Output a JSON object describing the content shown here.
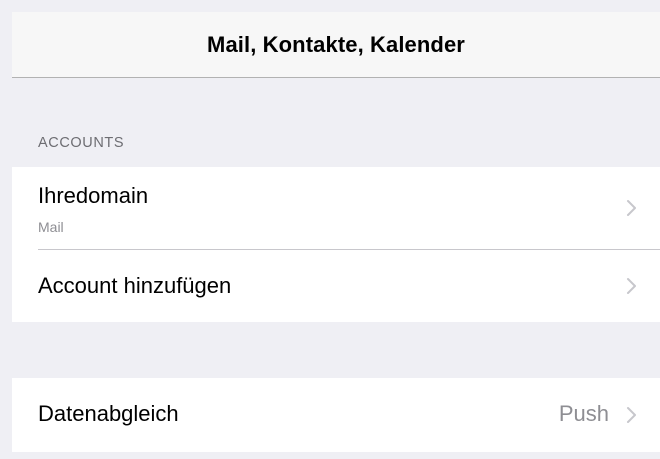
{
  "navbar": {
    "title": "Mail, Kontakte, Kalender"
  },
  "accounts_section": {
    "header": "ACCOUNTS",
    "items": [
      {
        "label": "Ihredomain",
        "sublabel": "Mail",
        "icon": "chevron-right-icon"
      },
      {
        "label": "Account hinzufügen",
        "icon": "chevron-right-icon"
      }
    ]
  },
  "sync_section": {
    "items": [
      {
        "label": "Datenabgleich",
        "value": "Push",
        "icon": "chevron-right-icon"
      }
    ]
  },
  "colors": {
    "background": "#efeff4",
    "navbar": "#f7f7f7",
    "cell": "#ffffff",
    "secondary_text": "#8e8e93",
    "section_header": "#6d6d72",
    "chevron": "#c7c7cc"
  }
}
